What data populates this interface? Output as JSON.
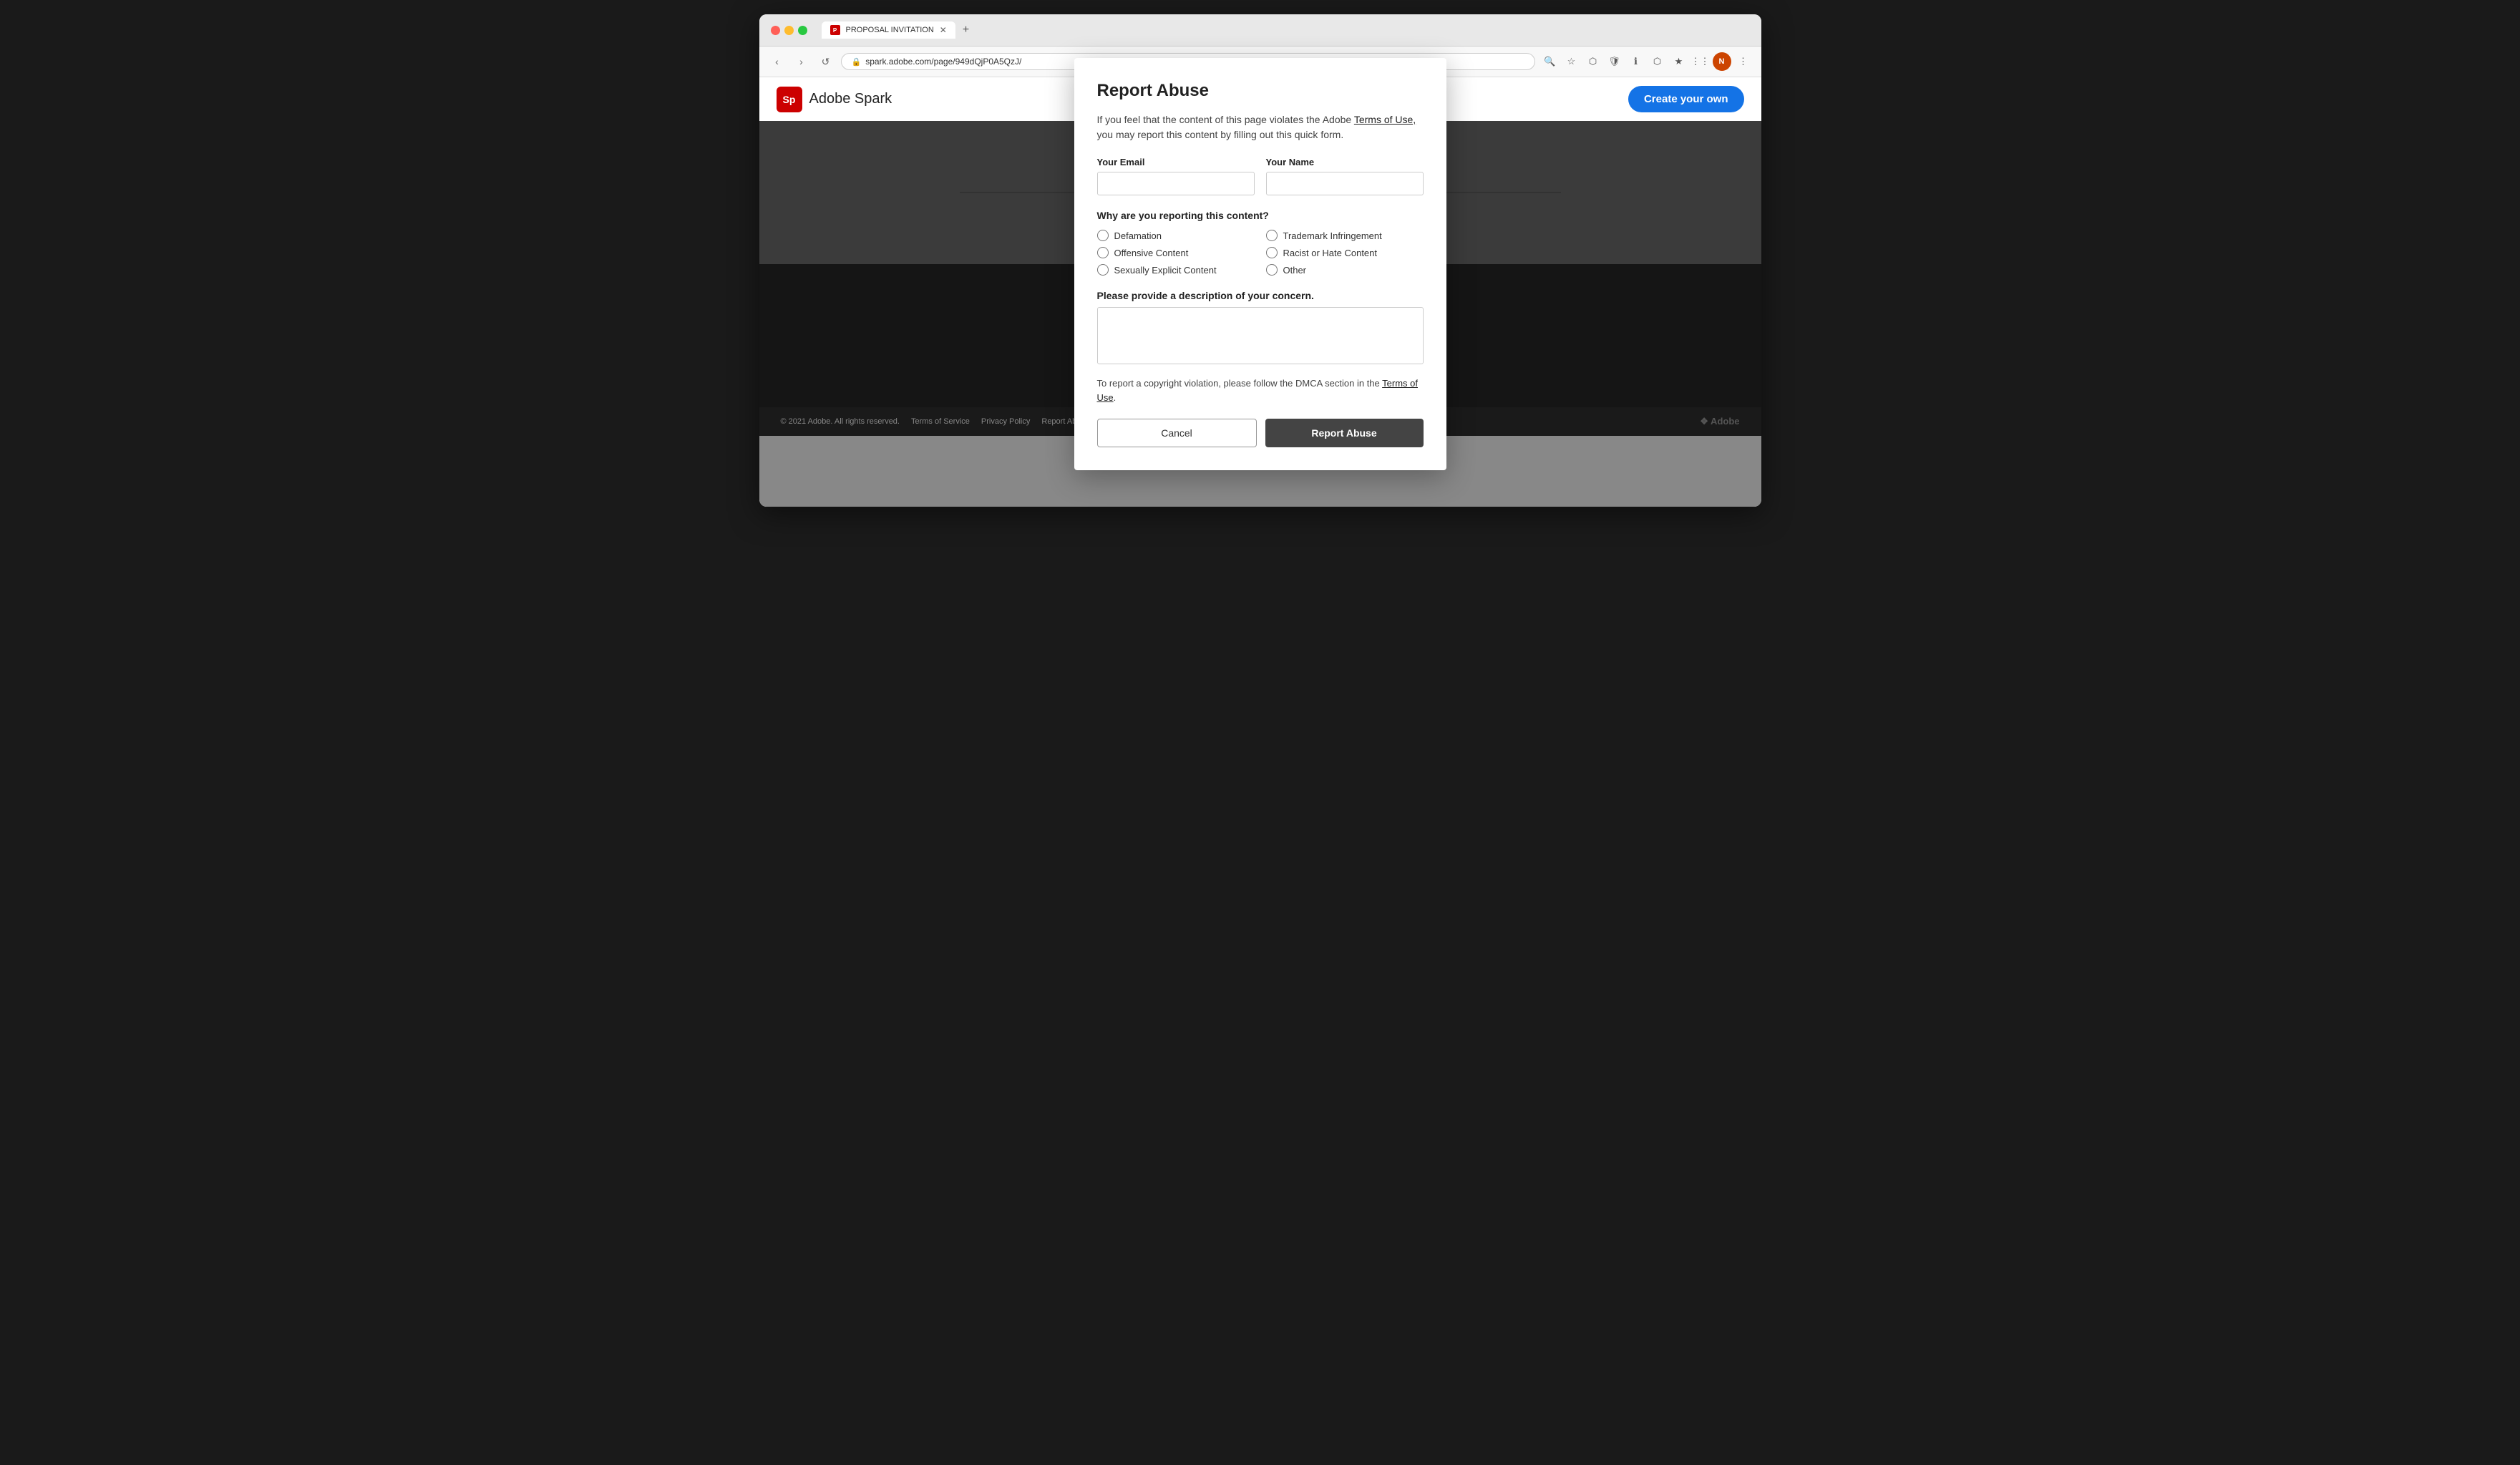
{
  "browser": {
    "tab_title": "PROPOSAL INVITATION",
    "url": "spark.adobe.com/page/949dQjP0A5QzJ/",
    "tab_favicon_text": "P",
    "new_tab_symbol": "+"
  },
  "header": {
    "logo_text": "Sp",
    "app_name": "Adobe Spark",
    "create_button_label": "Create your own"
  },
  "modal": {
    "title": "Report Abuse",
    "description_text": "If you feel that the content of this page violates the Adobe ",
    "terms_link_text": "Terms of Use,",
    "description_text2": " you may report this content by filling out this quick form.",
    "email_label": "Your Email",
    "name_label": "Your Name",
    "why_label": "Why are you reporting this content?",
    "radio_options": [
      {
        "id": "defamation",
        "label": "Defamation"
      },
      {
        "id": "trademark",
        "label": "Trademark Infringement"
      },
      {
        "id": "offensive",
        "label": "Offensive Content"
      },
      {
        "id": "racist",
        "label": "Racist or Hate Content"
      },
      {
        "id": "sexually-explicit",
        "label": "Sexually Explicit Content"
      },
      {
        "id": "other",
        "label": "Other"
      }
    ],
    "concern_label": "Please provide a description of your concern.",
    "copyright_text1": "To report a copyright violation, please follow the DMCA section in the ",
    "copyright_link_text": "Terms of Use",
    "copyright_text2": ".",
    "cancel_label": "Cancel",
    "report_label": "Report Abuse"
  },
  "footer": {
    "copyright": "© 2021 Adobe. All rights reserved.",
    "terms_link": "Terms of Service",
    "privacy_link": "Privacy Policy",
    "report_link": "Report Abuse",
    "adobe_logo": "❖ Adobe"
  }
}
